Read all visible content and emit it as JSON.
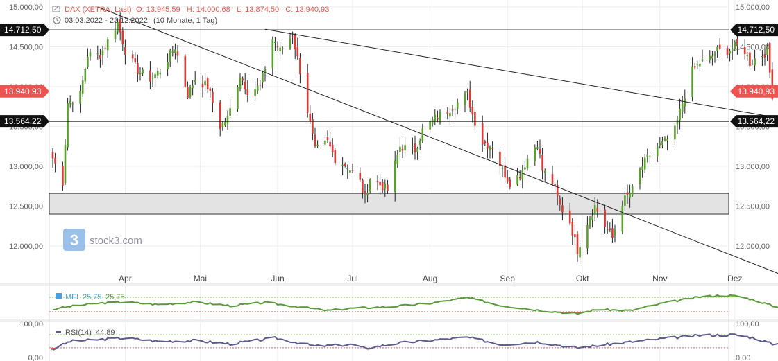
{
  "header": {
    "instrument": "DAX (XETRA, Last)",
    "ohlc": "O: 13.945,59   H: 14.000,68   L: 13.874,50   C: 13.940,93",
    "range": "03.03.2022 - 23.12.2022",
    "range_detail": "(10 Monate, 1 Tag)"
  },
  "watermark": {
    "text": "stock3.com",
    "logo_glyph": "3"
  },
  "colors": {
    "up": "#5aa02c",
    "down": "#d93a35",
    "price_tag": "#ef5350",
    "level_tag": "#111111",
    "mfi_line": "#5a9a3a",
    "mfi_marker": "#4aa0d8",
    "rsi_line": "#5e5a8c",
    "overbought_fill": "#8bd05a",
    "oversold_fill": "#e25555",
    "zone_fill": "#e3e3e3"
  },
  "chart_data": [
    {
      "type": "candlestick",
      "title": "DAX (XETRA, Last)",
      "ylim": [
        11500,
        15100
      ],
      "yticks": [
        12000,
        12500,
        13000,
        13500,
        14000,
        14500,
        15000
      ],
      "ytick_labels": [
        "12.000,00",
        "12.500,00",
        "13.000,00",
        "13.500,00",
        "14.000,00",
        "14.500,00",
        "15.000,00"
      ],
      "x_range": [
        "2022-03-03",
        "2022-12-23"
      ],
      "xticks": [
        {
          "date": "2022-04-01",
          "label": "Apr"
        },
        {
          "date": "2022-05-01",
          "label": "Mai"
        },
        {
          "date": "2022-06-01",
          "label": "Jun"
        },
        {
          "date": "2022-07-01",
          "label": "Jul"
        },
        {
          "date": "2022-08-01",
          "label": "Aug"
        },
        {
          "date": "2022-09-01",
          "label": "Sep"
        },
        {
          "date": "2022-10-01",
          "label": "Okt"
        },
        {
          "date": "2022-11-01",
          "label": "Nov"
        },
        {
          "date": "2022-12-01",
          "label": "Dez"
        }
      ],
      "close_anchors": [
        [
          "2022-03-03",
          13100
        ],
        [
          "2022-03-07",
          12800
        ],
        [
          "2022-03-09",
          13800
        ],
        [
          "2022-03-14",
          13900
        ],
        [
          "2022-03-17",
          14400
        ],
        [
          "2022-03-22",
          14400
        ],
        [
          "2022-03-29",
          14800
        ],
        [
          "2022-04-01",
          14450
        ],
        [
          "2022-04-06",
          14200
        ],
        [
          "2022-04-11",
          14100
        ],
        [
          "2022-04-15",
          14200
        ],
        [
          "2022-04-21",
          14500
        ],
        [
          "2022-04-26",
          13900
        ],
        [
          "2022-04-29",
          14100
        ],
        [
          "2022-05-04",
          14000
        ],
        [
          "2022-05-09",
          13500
        ],
        [
          "2022-05-12",
          13600
        ],
        [
          "2022-05-17",
          14150
        ],
        [
          "2022-05-20",
          13950
        ],
        [
          "2022-05-25",
          14000
        ],
        [
          "2022-05-30",
          14600
        ],
        [
          "2022-06-02",
          14450
        ],
        [
          "2022-06-07",
          14650
        ],
        [
          "2022-06-10",
          14200
        ],
        [
          "2022-06-16",
          13200
        ],
        [
          "2022-06-21",
          13300
        ],
        [
          "2022-06-24",
          13100
        ],
        [
          "2022-06-29",
          13000
        ],
        [
          "2022-07-04",
          12800
        ],
        [
          "2022-07-06",
          12600
        ],
        [
          "2022-07-08",
          12850
        ],
        [
          "2022-07-13",
          12750
        ],
        [
          "2022-07-15",
          12700
        ],
        [
          "2022-07-20",
          13250
        ],
        [
          "2022-07-26",
          13200
        ],
        [
          "2022-07-29",
          13450
        ],
        [
          "2022-08-03",
          13600
        ],
        [
          "2022-08-08",
          13700
        ],
        [
          "2022-08-12",
          13800
        ],
        [
          "2022-08-16",
          13900
        ],
        [
          "2022-08-18",
          13650
        ],
        [
          "2022-08-22",
          13300
        ],
        [
          "2022-08-26",
          13250
        ],
        [
          "2022-08-30",
          12950
        ],
        [
          "2022-09-02",
          12800
        ],
        [
          "2022-09-06",
          12900
        ],
        [
          "2022-09-09",
          13100
        ],
        [
          "2022-09-13",
          13300
        ],
        [
          "2022-09-15",
          12950
        ],
        [
          "2022-09-19",
          12800
        ],
        [
          "2022-09-22",
          12500
        ],
        [
          "2022-09-26",
          12300
        ],
        [
          "2022-09-29",
          11950
        ],
        [
          "2022-10-03",
          12300
        ],
        [
          "2022-10-06",
          12500
        ],
        [
          "2022-10-10",
          12250
        ],
        [
          "2022-10-13",
          12100
        ],
        [
          "2022-10-17",
          12550
        ],
        [
          "2022-10-21",
          12700
        ],
        [
          "2022-10-24",
          12950
        ],
        [
          "2022-10-27",
          13100
        ],
        [
          "2022-10-31",
          13250
        ],
        [
          "2022-11-03",
          13300
        ],
        [
          "2022-11-07",
          13450
        ],
        [
          "2022-11-10",
          13800
        ],
        [
          "2022-11-14",
          14200
        ],
        [
          "2022-11-17",
          14300
        ],
        [
          "2022-11-21",
          14350
        ],
        [
          "2022-11-24",
          14450
        ],
        [
          "2022-11-28",
          14450
        ],
        [
          "2022-12-01",
          14500
        ],
        [
          "2022-12-05",
          14450
        ],
        [
          "2022-12-07",
          14300
        ],
        [
          "2022-12-09",
          14350
        ],
        [
          "2022-12-12",
          14400
        ],
        [
          "2022-12-14",
          14450
        ],
        [
          "2022-12-16",
          13900
        ],
        [
          "2022-12-20",
          13900
        ],
        [
          "2022-12-23",
          13940.93
        ]
      ],
      "last_candle": {
        "date": "2022-12-23",
        "open": 13945.59,
        "high": 14000.68,
        "low": 13874.5,
        "close": 13940.93
      },
      "horizontal_lines": [
        {
          "value": 14712.5,
          "label": "14.712,50"
        },
        {
          "value": 13564.22,
          "label": "13.564,22"
        }
      ],
      "support_zone": [
        12400,
        12660
      ],
      "trendlines": [
        {
          "from": [
            "2022-03-21",
            15000
          ],
          "to": [
            "2022-12-31",
            11500
          ]
        },
        {
          "from": [
            "2022-05-27",
            14720
          ],
          "to": [
            "2022-12-31",
            13540
          ]
        }
      ],
      "last_price": {
        "value": 13940.93,
        "label": "13.940,93"
      }
    },
    {
      "type": "line",
      "name": "MFI",
      "legend": "MFI",
      "legend_value_blue": "25,75",
      "legend_value_green": "25,75",
      "ylim": [
        0,
        100
      ],
      "bands": [
        80,
        20
      ],
      "anchors": [
        [
          "2022-03-03",
          30
        ],
        [
          "2022-03-10",
          42
        ],
        [
          "2022-03-21",
          55
        ],
        [
          "2022-04-01",
          60
        ],
        [
          "2022-04-14",
          50
        ],
        [
          "2022-04-29",
          60
        ],
        [
          "2022-05-13",
          45
        ],
        [
          "2022-05-27",
          58
        ],
        [
          "2022-06-10",
          40
        ],
        [
          "2022-06-21",
          25
        ],
        [
          "2022-07-01",
          35
        ],
        [
          "2022-07-15",
          40
        ],
        [
          "2022-08-01",
          55
        ],
        [
          "2022-08-16",
          78
        ],
        [
          "2022-08-30",
          45
        ],
        [
          "2022-09-15",
          25
        ],
        [
          "2022-09-29",
          12
        ],
        [
          "2022-10-07",
          30
        ],
        [
          "2022-10-20",
          25
        ],
        [
          "2022-11-02",
          55
        ],
        [
          "2022-11-16",
          80
        ],
        [
          "2022-11-25",
          88
        ],
        [
          "2022-12-02",
          85
        ],
        [
          "2022-12-09",
          68
        ],
        [
          "2022-12-16",
          45
        ],
        [
          "2022-12-23",
          25.75
        ]
      ]
    },
    {
      "type": "line",
      "name": "RSI(14)",
      "legend": "RSI(14)",
      "legend_value": "44,89",
      "ylim": [
        0,
        100
      ],
      "yticks": [
        0,
        100
      ],
      "ytick_labels": [
        "0,00",
        "100,00"
      ],
      "bands": [
        70,
        30
      ],
      "anchors": [
        [
          "2022-03-03",
          25
        ],
        [
          "2022-03-10",
          50
        ],
        [
          "2022-03-21",
          55
        ],
        [
          "2022-04-01",
          60
        ],
        [
          "2022-04-14",
          50
        ],
        [
          "2022-04-29",
          52
        ],
        [
          "2022-05-13",
          42
        ],
        [
          "2022-05-31",
          60
        ],
        [
          "2022-06-16",
          35
        ],
        [
          "2022-07-01",
          40
        ],
        [
          "2022-07-06",
          28
        ],
        [
          "2022-07-20",
          45
        ],
        [
          "2022-08-16",
          62
        ],
        [
          "2022-08-30",
          40
        ],
        [
          "2022-09-13",
          48
        ],
        [
          "2022-09-29",
          30
        ],
        [
          "2022-10-20",
          48
        ],
        [
          "2022-11-02",
          58
        ],
        [
          "2022-11-17",
          68
        ],
        [
          "2022-12-01",
          70
        ],
        [
          "2022-12-09",
          60
        ],
        [
          "2022-12-16",
          42
        ],
        [
          "2022-12-23",
          44.89
        ]
      ]
    }
  ]
}
